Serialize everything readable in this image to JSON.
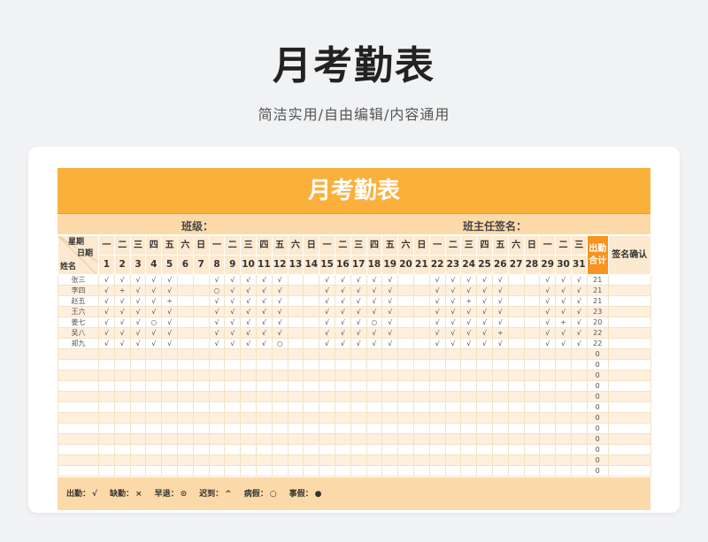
{
  "page": {
    "title": "月考勤表",
    "subtitle": "简洁实用/自由编辑/内容通用"
  },
  "sheet": {
    "title": "月考勤表",
    "class_label": "班级：",
    "teacher_sign_label": "班主任签名：",
    "corner": {
      "weekday": "星期",
      "date": "日期",
      "name": "姓名"
    },
    "weekdays": [
      "一",
      "二",
      "三",
      "四",
      "五",
      "六",
      "日",
      "一",
      "二",
      "三",
      "四",
      "五",
      "六",
      "日",
      "一",
      "二",
      "三",
      "四",
      "五",
      "六",
      "日",
      "一",
      "二",
      "三",
      "四",
      "五",
      "六",
      "日",
      "一",
      "二",
      "三"
    ],
    "days": [
      "1",
      "2",
      "3",
      "4",
      "5",
      "6",
      "7",
      "8",
      "9",
      "10",
      "11",
      "12",
      "13",
      "14",
      "15",
      "16",
      "17",
      "18",
      "19",
      "20",
      "21",
      "22",
      "23",
      "24",
      "25",
      "26",
      "27",
      "28",
      "29",
      "30",
      "31"
    ],
    "total_label_1": "出勤",
    "total_label_2": "合计",
    "sign_confirm_label": "签名确认",
    "rows": [
      {
        "name": "张三",
        "marks": [
          "√",
          "√",
          "√",
          "√",
          "√",
          "",
          "",
          "√",
          "√",
          "√",
          "√",
          "√",
          "",
          "",
          "√",
          "√",
          "√",
          "√",
          "√",
          "",
          "",
          "√",
          "√",
          "√",
          "√",
          "√",
          "",
          "",
          "√",
          "√",
          "√"
        ],
        "total": "21"
      },
      {
        "name": "李四",
        "marks": [
          "√",
          "÷",
          "√",
          "√",
          "√",
          "",
          "",
          "○",
          "√",
          "√",
          "√",
          "√",
          "",
          "",
          "√",
          "√",
          "√",
          "√",
          "√",
          "",
          "",
          "√",
          "√",
          "√",
          "√",
          "√",
          "",
          "",
          "√",
          "√",
          "√"
        ],
        "total": "21"
      },
      {
        "name": "赵五",
        "marks": [
          "√",
          "√",
          "√",
          "√",
          "÷",
          "",
          "",
          "√",
          "√",
          "√",
          "√",
          "√",
          "",
          "",
          "√",
          "√",
          "√",
          "√",
          "√",
          "",
          "",
          "√",
          "√",
          "÷",
          "√",
          "√",
          "",
          "",
          "√",
          "√",
          "√"
        ],
        "total": "21"
      },
      {
        "name": "王六",
        "marks": [
          "√",
          "√",
          "√",
          "√",
          "√",
          "",
          "",
          "√",
          "√",
          "√",
          "√",
          "√",
          "",
          "",
          "√",
          "√",
          "√",
          "√",
          "√",
          "",
          "",
          "√",
          "√",
          "√",
          "√",
          "√",
          "",
          "",
          "√",
          "√",
          "√"
        ],
        "total": "23"
      },
      {
        "name": "姜七",
        "marks": [
          "√",
          "√",
          "√",
          "○",
          "√",
          "",
          "",
          "√",
          "√",
          "√",
          "√",
          "√",
          "",
          "",
          "√",
          "√",
          "√",
          "○",
          "√",
          "",
          "",
          "√",
          "√",
          "√",
          "√",
          "√",
          "",
          "",
          "√",
          "÷",
          "√"
        ],
        "total": "20"
      },
      {
        "name": "吴八",
        "marks": [
          "√",
          "√",
          "√",
          "√",
          "√",
          "",
          "",
          "√",
          "√",
          "√",
          "√",
          "√",
          "",
          "",
          "√",
          "√",
          "√",
          "√",
          "√",
          "",
          "",
          "√",
          "√",
          "√",
          "√",
          "÷",
          "",
          "",
          "√",
          "√",
          "√"
        ],
        "total": "22"
      },
      {
        "name": "郑九",
        "marks": [
          "√",
          "√",
          "√",
          "√",
          "√",
          "",
          "",
          "√",
          "√",
          "√",
          "√",
          "○",
          "",
          "",
          "√",
          "√",
          "√",
          "√",
          "√",
          "",
          "",
          "√",
          "√",
          "√",
          "√",
          "√",
          "",
          "",
          "√",
          "√",
          "√"
        ],
        "total": "22"
      }
    ],
    "empty_rows": 12,
    "empty_total": "0"
  },
  "legend": [
    {
      "label": "出勤：",
      "symbol": "√"
    },
    {
      "label": "缺勤：",
      "symbol": "×"
    },
    {
      "label": "早退：",
      "symbol": "⊙"
    },
    {
      "label": "迟到：",
      "symbol": "^"
    },
    {
      "label": "病假：",
      "symbol": "○"
    },
    {
      "label": "事假：",
      "symbol": "●"
    }
  ],
  "colors": {
    "accent": "#fbb03b",
    "total_header": "#f7931e",
    "band": "#fcd9a8",
    "header_bg": "#fde9cf",
    "row_alt": "#fef0dc"
  }
}
